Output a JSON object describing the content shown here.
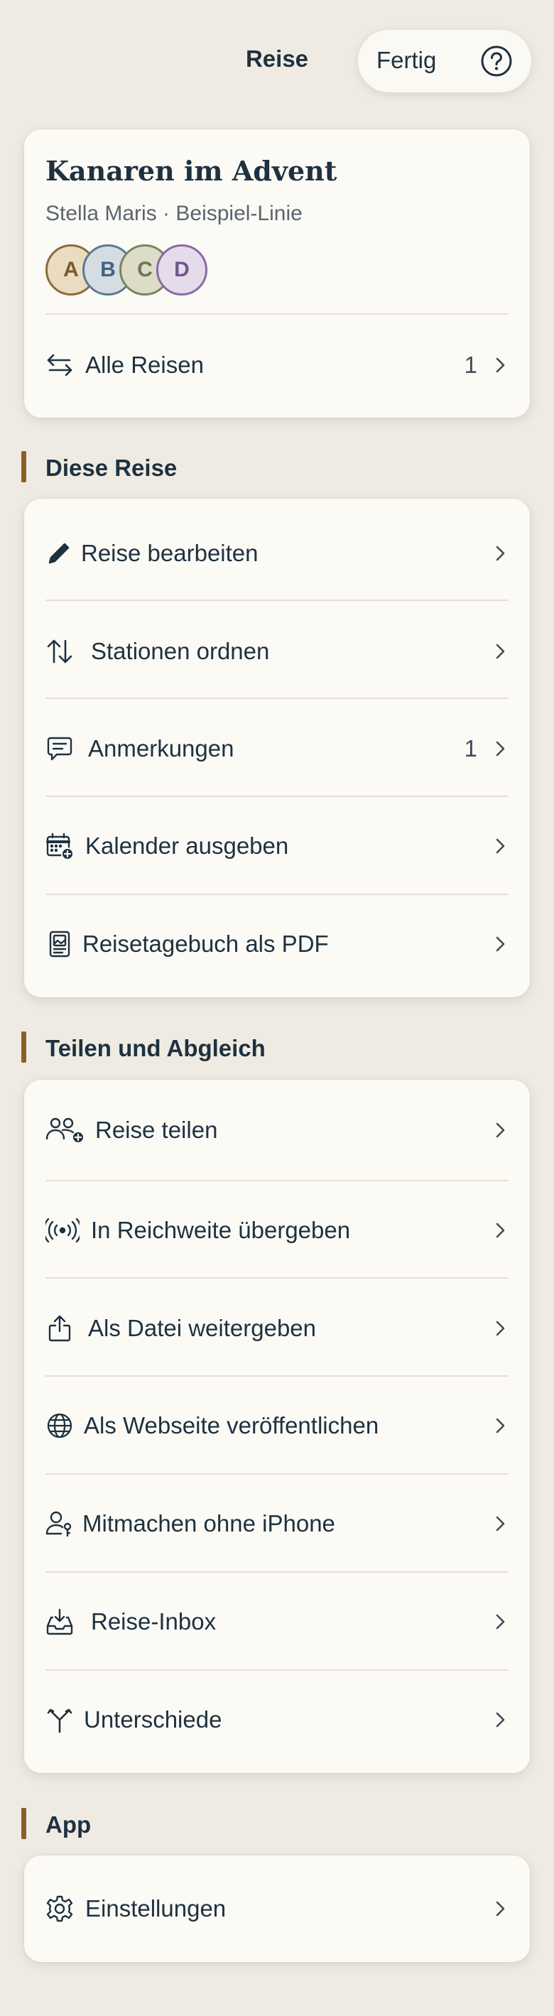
{
  "nav": {
    "title": "Reise",
    "done_label": "Fertig",
    "help_icon": "question-circle-icon"
  },
  "trip": {
    "title": "Kanaren im Advent",
    "subtitle": "Stella Maris · Beispiel-Linie",
    "avatars": [
      {
        "initial": "A",
        "bg": "#e9dcc0",
        "border": "#8b6b3a",
        "color": "#7a5a2a"
      },
      {
        "initial": "B",
        "bg": "#d5dde3",
        "border": "#5b7a92",
        "color": "#3f6482"
      },
      {
        "initial": "C",
        "bg": "#dcdcc8",
        "border": "#7a8460",
        "color": "#6e7650"
      },
      {
        "initial": "D",
        "bg": "#e4dcea",
        "border": "#8a6aa6",
        "color": "#72548f"
      }
    ],
    "all_trips": {
      "label": "Alle Reisen",
      "count": "1",
      "icon": "swap-arrows-icon"
    }
  },
  "sections": {
    "this_trip": {
      "title": "Diese Reise",
      "items": [
        {
          "label": "Reise bearbeiten",
          "icon": "pencil-icon"
        },
        {
          "label": "Stationen ordnen",
          "icon": "sort-arrows-icon"
        },
        {
          "label": "Anmerkungen",
          "icon": "comment-icon",
          "count": "1"
        },
        {
          "label": "Kalender ausgeben",
          "icon": "calendar-add-icon"
        },
        {
          "label": "Reisetagebuch als PDF",
          "icon": "document-image-icon"
        }
      ]
    },
    "sharing": {
      "title": "Teilen und Abgleich",
      "items": [
        {
          "label": "Reise teilen",
          "icon": "people-add-icon"
        },
        {
          "label": "In Reichweite übergeben",
          "icon": "broadcast-icon"
        },
        {
          "label": "Als Datei weitergeben",
          "icon": "share-icon"
        },
        {
          "label": "Als Webseite veröffentlichen",
          "icon": "globe-icon"
        },
        {
          "label": "Mitmachen ohne iPhone",
          "icon": "person-key-icon"
        },
        {
          "label": "Reise-Inbox",
          "icon": "inbox-icon"
        },
        {
          "label": "Unterschiede",
          "icon": "merge-icon"
        }
      ]
    },
    "app": {
      "title": "App",
      "items": [
        {
          "label": "Einstellungen",
          "icon": "gear-icon"
        }
      ]
    }
  },
  "colors": {
    "background": "#efebe2",
    "card": "#fcfaf5",
    "accent": "#8b6028",
    "text": "#1e3140"
  }
}
